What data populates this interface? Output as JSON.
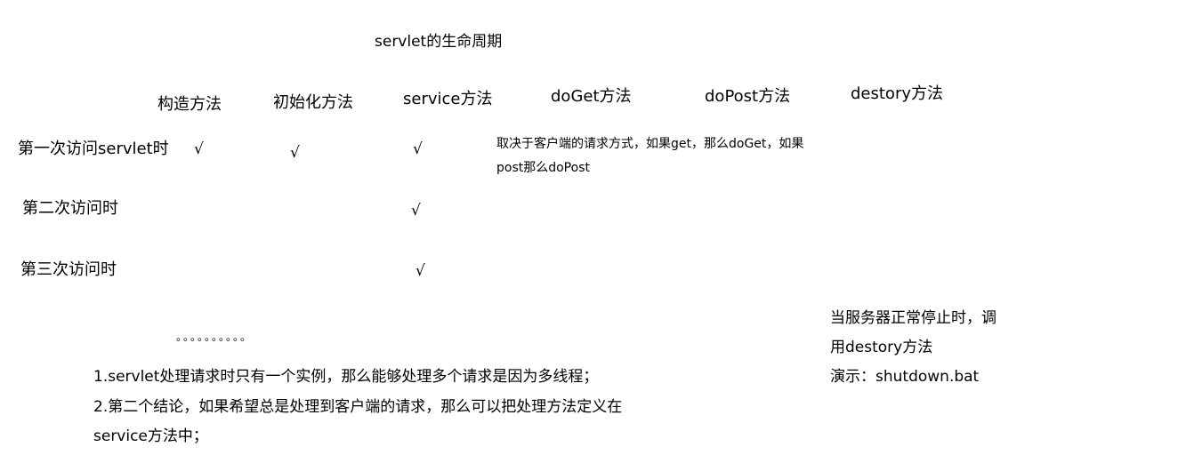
{
  "title": "servlet的生命周期",
  "columns": [
    "构造方法",
    "初始化方法",
    "service方法",
    "doGet方法",
    "doPost方法",
    "destory方法"
  ],
  "rows": [
    {
      "label": "第一次访问servlet时",
      "checks": [
        "√",
        "√",
        "√"
      ]
    },
    {
      "label": "第二次访问时",
      "checks": [
        "√"
      ]
    },
    {
      "label": "第三次访问时",
      "checks": [
        "√"
      ]
    }
  ],
  "doget_note": [
    "取决于客户端的请求方式，如果get，那么doGet，如果",
    "post那么doPost"
  ],
  "ellipsis": "。。。。。。。。。。",
  "conclusions": [
    "1.servlet处理请求时只有一个实例，那么能够处理多个请求是因为多线程；",
    "2.第二个结论，如果希望总是处理到客户端的请求，那么可以把处理方法定义在",
    "service方法中；"
  ],
  "destroy_note": [
    "当服务器正常停止时，调",
    "用destory方法",
    "演示：shutdown.bat"
  ]
}
